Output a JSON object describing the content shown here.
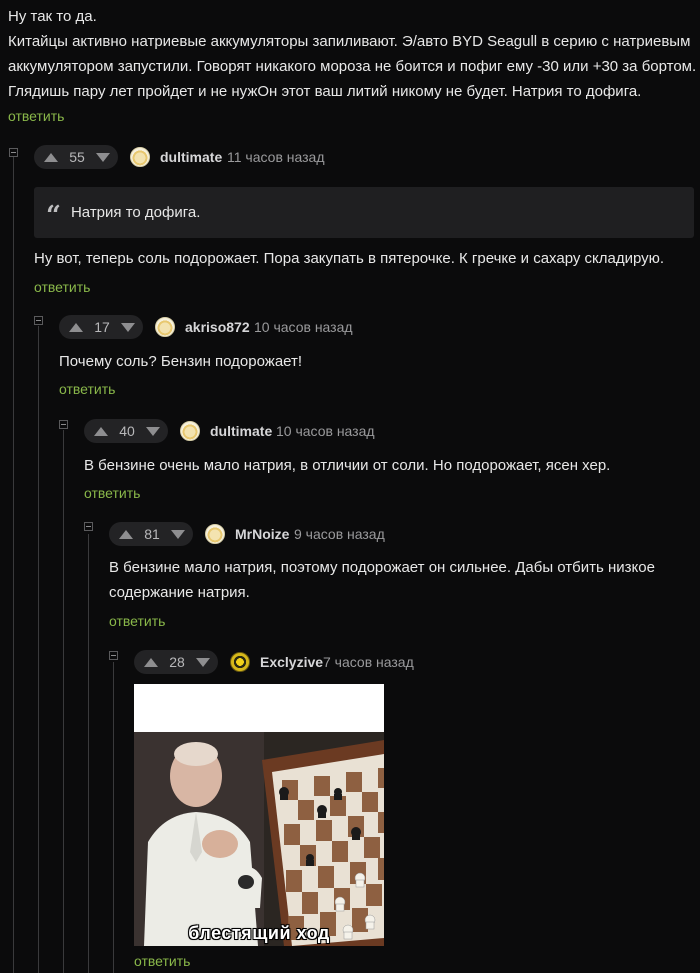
{
  "top_comment": {
    "lines": [
      "Ну так то да.",
      "Китайцы активно натриевые аккумуляторы запиливают. Э/авто BYD Seagull в серию с натриевым",
      "аккумулятором запустили. Говорят никакого мороза не боится и пофиг ему -30 или +30 за бортом.",
      "Глядишь пару лет пройдет и не нужОн этот ваш литий никому не будет. Натрия то дофига."
    ],
    "reply_label": "ответить"
  },
  "comments": [
    {
      "votes": "55",
      "user": "dultimate",
      "time": "11 часов назад",
      "quote": "Натрия то дофига.",
      "lines": [
        "Ну вот, теперь соль подорожает. Пора закупать в пятерочке. К гречке и сахару складирую."
      ],
      "reply_label": "ответить"
    },
    {
      "votes": "17",
      "user": "akriso872",
      "time": "10 часов назад",
      "lines": [
        "Почему соль? Бензин подорожает!"
      ],
      "reply_label": "ответить"
    },
    {
      "votes": "40",
      "user": "dultimate",
      "time": "10 часов назад",
      "lines": [
        "В бензине очень мало натрия, в отличии от соли. Но подорожает, ясен хер."
      ],
      "reply_label": "ответить"
    },
    {
      "votes": "81",
      "user": "MrNoize",
      "time": "9 часов назад",
      "lines": [
        "В бензине мало натрия, поэтому подорожает он сильнее. Дабы отбить низкое",
        "содержание натрия."
      ],
      "reply_label": "ответить"
    },
    {
      "votes": "28",
      "user": "Exclyzive",
      "time": "7 часов назад",
      "image_caption": "блестящий ход",
      "reply_label": "ответить"
    }
  ],
  "colors": {
    "background": "#0b0b0c",
    "reply_link": "#8ab84a",
    "vote_pill": "#232325",
    "quote_bg": "#1f1f21"
  },
  "icons": {
    "upvote": "arrow-up-icon",
    "downvote": "arrow-down-icon",
    "collapse": "collapse-icon",
    "quote": "quote-icon"
  }
}
